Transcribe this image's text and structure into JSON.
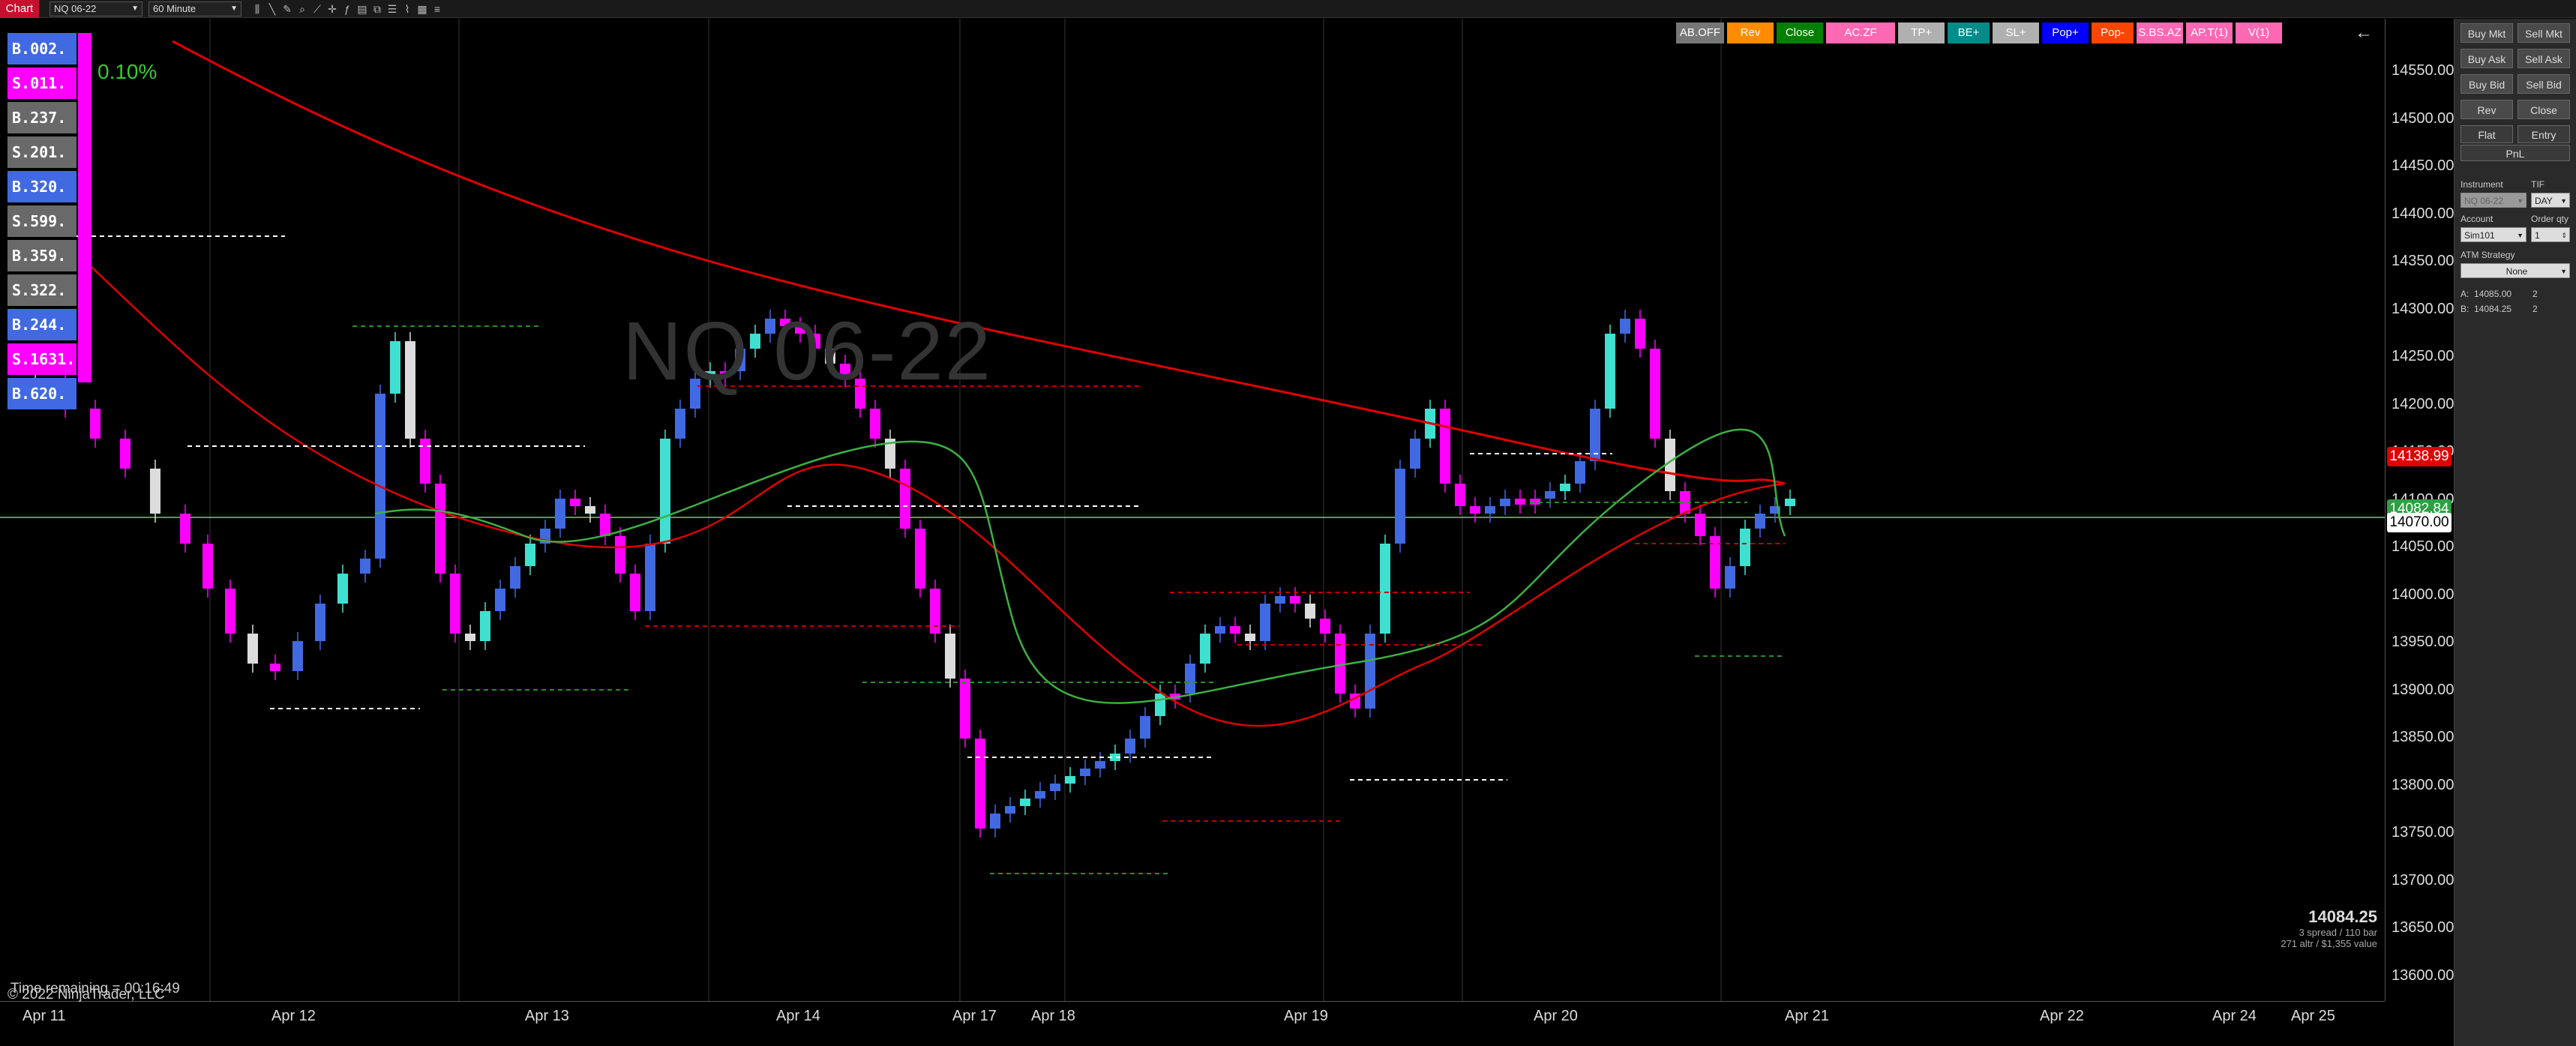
{
  "toolbar": {
    "chart_tab": "Chart",
    "instrument": "NQ 06-22",
    "interval": "60 Minute"
  },
  "chart": {
    "watermark": "NQ 06-22",
    "percent": "0.10%",
    "buttons": [
      {
        "label": "AB.OFF",
        "color": "#777777"
      },
      {
        "label": "Rev",
        "color": "#ff8c00"
      },
      {
        "label": "Close",
        "color": "#008000"
      },
      {
        "label": "AC.ZF",
        "color": "#ff69b4"
      },
      {
        "label": "TP+",
        "color": "#b0b0b0"
      },
      {
        "label": "BE+",
        "color": "#008b8b"
      },
      {
        "label": "SL+",
        "color": "#b0b0b0"
      },
      {
        "label": "Pop+",
        "color": "#0000ff"
      },
      {
        "label": "Pop-",
        "color": "#ff4500"
      },
      {
        "label": "S.BS.AZ",
        "color": "#ff69b4"
      },
      {
        "label": "AP.T(1)",
        "color": "#ff69b4"
      },
      {
        "label": "V(1)",
        "color": "#ff69b4"
      }
    ],
    "orders": [
      {
        "label": "B.002.",
        "color": "#4169e1"
      },
      {
        "label": "S.011.",
        "color": "#ff00ff"
      },
      {
        "label": "B.237.",
        "color": "#696969"
      },
      {
        "label": "S.201.",
        "color": "#696969"
      },
      {
        "label": "B.320.",
        "color": "#4169e1"
      },
      {
        "label": "S.599.",
        "color": "#696969"
      },
      {
        "label": "B.359.",
        "color": "#696969"
      },
      {
        "label": "S.322.",
        "color": "#696969"
      },
      {
        "label": "B.244.",
        "color": "#4169e1"
      },
      {
        "label": "S.1631.",
        "color": "#ff00ff"
      },
      {
        "label": "B.620.",
        "color": "#4169e1"
      }
    ],
    "info": {
      "price": "14084.25",
      "line1": "3 spread / 110 bar",
      "line2": "271 altr / $1,355 value"
    },
    "status_time": "Time remaining = 00:16:49",
    "copyright": "© 2022 NinjaTrader, LLC"
  },
  "price_axis": {
    "ticks": [
      "14550.00",
      "14500.00",
      "14450.00",
      "14400.00",
      "14350.00",
      "14300.00",
      "14250.00",
      "14200.00",
      "14150.00",
      "14100.00",
      "14050.00",
      "14000.00",
      "13950.00",
      "13900.00",
      "13850.00",
      "13800.00",
      "13750.00",
      "13700.00",
      "13650.00",
      "13600.00"
    ],
    "flags": [
      {
        "label": "14138.99",
        "color": "#e00000",
        "fg": "#ffffff"
      },
      {
        "label": "14082.84",
        "color": "#2ea043",
        "fg": "#ffffff"
      },
      {
        "label": "14070.00",
        "color": "#ffffff",
        "fg": "#000000"
      }
    ]
  },
  "time_axis": {
    "labels": [
      "Apr 11",
      "Apr 12",
      "Apr 13",
      "Apr 14",
      "Apr 17",
      "Apr 18",
      "Apr 19",
      "Apr 20",
      "Apr 21",
      "Apr 22",
      "Apr 24",
      "Apr 25"
    ]
  },
  "panel": {
    "buy_mkt": "Buy Mkt",
    "sell_mkt": "Sell Mkt",
    "buy_ask": "Buy Ask",
    "sell_ask": "Sell Ask",
    "buy_bid": "Buy Bid",
    "sell_bid": "Sell Bid",
    "rev": "Rev",
    "close": "Close",
    "flat": "Flat",
    "entry": "Entry",
    "pnl": "PnL",
    "instrument_label": "Instrument",
    "tif_label": "TIF",
    "instrument_value": "NQ 06-22",
    "tif_value": "DAY",
    "account_label": "Account",
    "order_qty_label": "Order qty",
    "account_value": "Sim101",
    "qty_value": "1",
    "atm_label": "ATM Strategy",
    "atm_value": "None",
    "ask_label": "A:",
    "ask_price": "14085.00",
    "ask_size": "2",
    "bid_label": "B:",
    "bid_price": "14084.25",
    "bid_size": "2"
  }
}
